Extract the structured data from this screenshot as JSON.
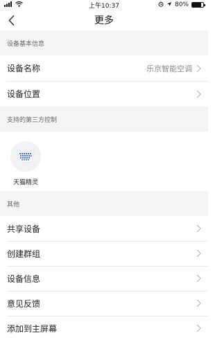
{
  "status_bar": {
    "time": "上午10:37",
    "battery": "80%",
    "battery_level": 0.8
  },
  "nav": {
    "title": "更多"
  },
  "sections": {
    "basic_info": {
      "header": "设备基本信息",
      "rows": [
        {
          "label": "设备名称",
          "value": "乐京智能空调"
        },
        {
          "label": "设备位置",
          "value": ""
        }
      ]
    },
    "third_party": {
      "header": "支持的第三方控制",
      "items": [
        {
          "label": "天猫精灵",
          "icon": "tmall-genie-icon"
        }
      ]
    },
    "other": {
      "header": "其他",
      "rows": [
        {
          "label": "共享设备"
        },
        {
          "label": "创建群组"
        },
        {
          "label": "设备信息"
        },
        {
          "label": "意见反馈"
        },
        {
          "label": "添加到主屏幕"
        }
      ]
    }
  },
  "colors": {
    "section_bg": "#f4f4f6",
    "divider": "#ececec",
    "value_text": "#8a8a8a",
    "chevron": "#b5b5b5",
    "logo_blue": "#3a6df0"
  }
}
